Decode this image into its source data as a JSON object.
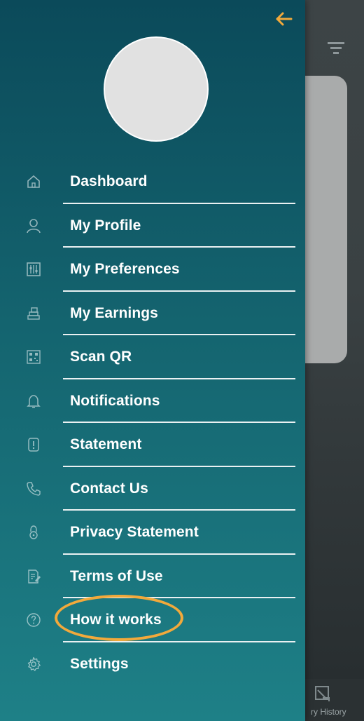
{
  "colors": {
    "drawer_top": "#0b4a5a",
    "drawer_bottom": "#1e8087",
    "accent": "#f2a93b",
    "divider": "#eaf1f2",
    "label": "#ffffff"
  },
  "header": {
    "back_icon": "arrow-left-icon"
  },
  "background": {
    "bottom_tab_label": "ry History"
  },
  "menu": {
    "items": [
      {
        "label": "Dashboard",
        "icon": "home-icon"
      },
      {
        "label": "My Profile",
        "icon": "user-icon"
      },
      {
        "label": "My Preferences",
        "icon": "sliders-icon"
      },
      {
        "label": "My Earnings",
        "icon": "coins-icon"
      },
      {
        "label": "Scan QR",
        "icon": "qr-code-icon"
      },
      {
        "label": "Notifications",
        "icon": "bell-icon"
      },
      {
        "label": "Statement",
        "icon": "statement-icon"
      },
      {
        "label": "Contact Us",
        "icon": "phone-icon"
      },
      {
        "label": "Privacy Statement",
        "icon": "lock-icon"
      },
      {
        "label": "Terms of Use",
        "icon": "document-edit-icon"
      },
      {
        "label": "How it works",
        "icon": "help-circle-icon",
        "highlighted": true
      },
      {
        "label": "Settings",
        "icon": "gear-icon"
      }
    ]
  }
}
